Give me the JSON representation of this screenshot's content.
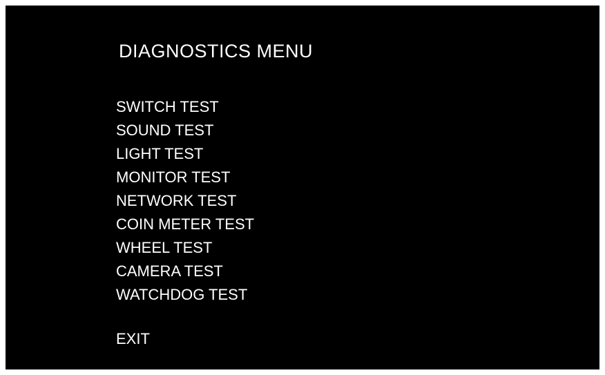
{
  "title": "DIAGNOSTICS MENU",
  "menu": {
    "items": [
      {
        "label": "SWITCH TEST"
      },
      {
        "label": "SOUND TEST"
      },
      {
        "label": "LIGHT TEST"
      },
      {
        "label": "MONITOR TEST"
      },
      {
        "label": "NETWORK TEST"
      },
      {
        "label": "COIN METER TEST"
      },
      {
        "label": "WHEEL TEST"
      },
      {
        "label": "CAMERA TEST"
      },
      {
        "label": "WATCHDOG TEST"
      }
    ]
  },
  "exit": {
    "label": "EXIT"
  },
  "colors": {
    "background": "#000000",
    "text": "#ffffff"
  }
}
